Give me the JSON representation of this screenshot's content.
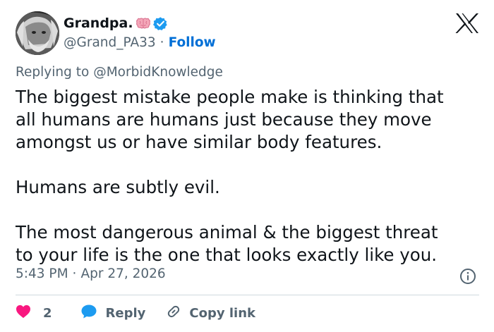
{
  "author": {
    "display_name": "Grandpa.",
    "handle": "@Grand_PA33",
    "separator": "·",
    "follow_label": "Follow",
    "badge_icon": "verified-badge-icon",
    "emoji_icon": "brain-emoji-icon",
    "verified_color": "#1d9bf0"
  },
  "platform_logo": "x-logo-icon",
  "reply_context": {
    "prefix": "Replying to",
    "mention": "@MorbidKnowledge"
  },
  "tweet": {
    "lines": [
      "The biggest mistake people make is thinking that",
      "all humans are humans just because they move",
      "amongst us or have similar body features.",
      "Humans are subtly evil.",
      "The most dangerous animal & the biggest threat",
      "to your life is the one that looks exactly like you."
    ]
  },
  "meta": {
    "time": "5:43 PM",
    "separator": "·",
    "date": "Apr 27, 2026",
    "info_icon": "info-icon"
  },
  "actions": {
    "like_count": "2",
    "like_icon": "heart-icon",
    "like_color": "#f91880",
    "reply_label": "Reply",
    "reply_icon": "speech-bubble-icon",
    "reply_color": "#1d9bf0",
    "copy_label": "Copy link",
    "copy_icon": "link-icon"
  },
  "colors": {
    "link_blue": "#006fd6",
    "muted_text": "#536471",
    "divider": "#cfd9de"
  }
}
